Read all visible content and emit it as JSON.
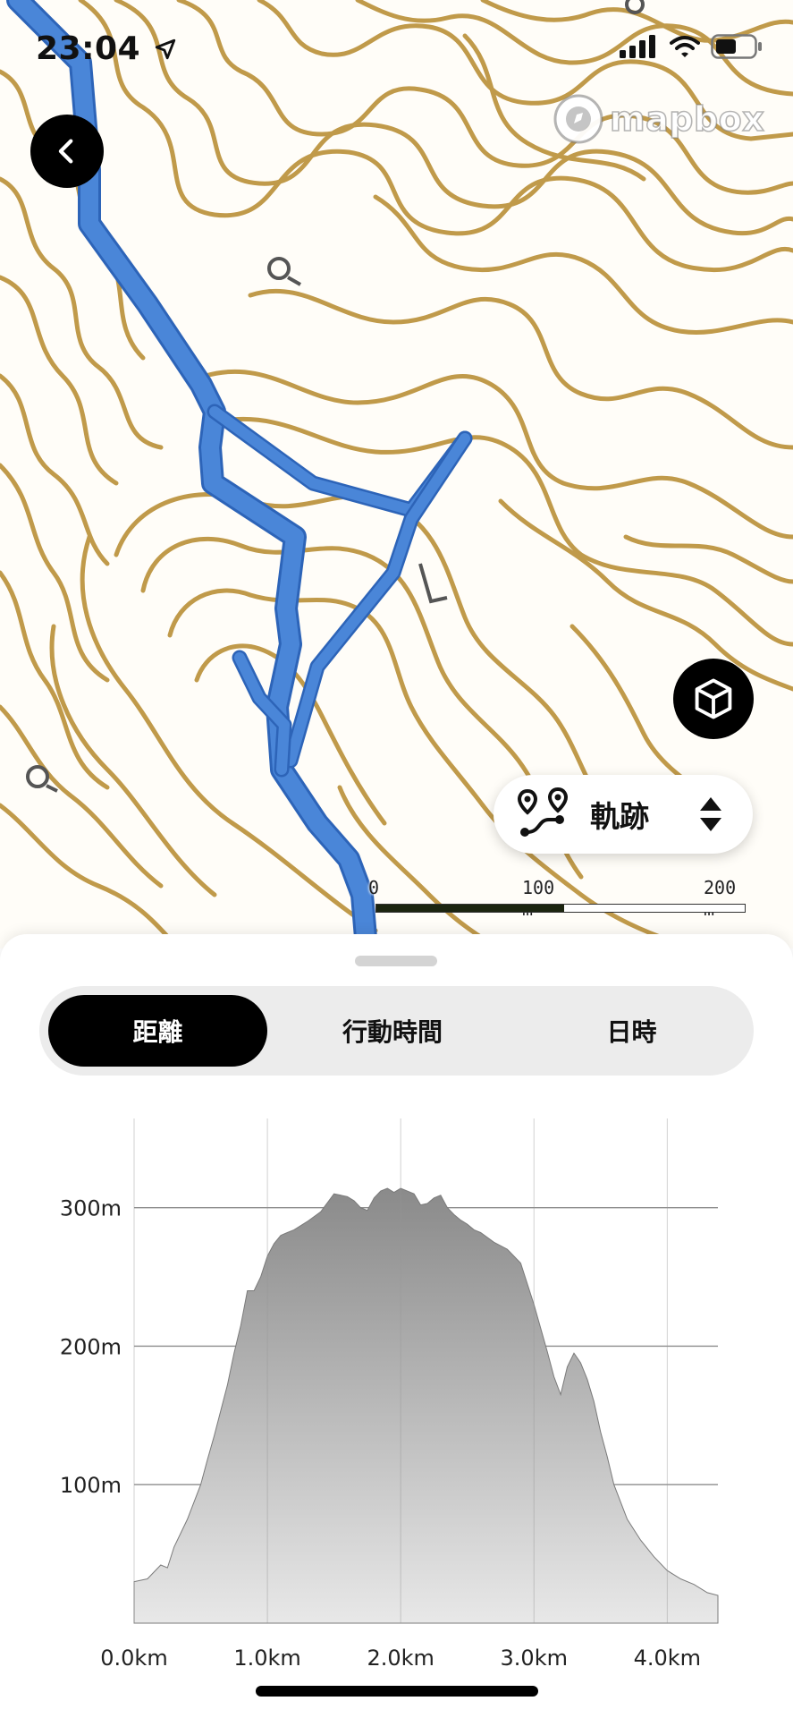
{
  "status_bar": {
    "time": "23:04"
  },
  "map": {
    "attribution": "mapbox",
    "contour_color": "#c09a4a",
    "track_color": "#4a86d8",
    "scale": {
      "labels": [
        "0",
        "100 m",
        "200 m"
      ]
    }
  },
  "buttons": {
    "back_icon": "chevron-left-icon",
    "view_3d_icon": "cube-icon",
    "track_selector": {
      "icon": "route-icon",
      "label": "軌跡",
      "icon_right": "sort-arrows-icon"
    }
  },
  "tabs": [
    {
      "label": "距離",
      "active": true
    },
    {
      "label": "行動時間",
      "active": false
    },
    {
      "label": "日時",
      "active": false
    }
  ],
  "chart_data": {
    "type": "area",
    "title": "",
    "xlabel": "",
    "ylabel": "",
    "x_unit": "km",
    "y_unit": "m",
    "x_ticks": [
      "0.0km",
      "1.0km",
      "2.0km",
      "3.0km",
      "4.0km"
    ],
    "y_ticks": [
      "100m",
      "200m",
      "300m"
    ],
    "xlim": [
      0,
      4.38
    ],
    "ylim": [
      0,
      345
    ],
    "grid": true,
    "series": [
      {
        "x": [
          0.0,
          0.1,
          0.2,
          0.25,
          0.3,
          0.4,
          0.5,
          0.55,
          0.6,
          0.7,
          0.75,
          0.8,
          0.85,
          0.9,
          0.95,
          1.0,
          1.05,
          1.1,
          1.15,
          1.2,
          1.3,
          1.4,
          1.5,
          1.6,
          1.65,
          1.7,
          1.75,
          1.8,
          1.85,
          1.9,
          1.95,
          2.0,
          2.05,
          2.1,
          2.15,
          2.2,
          2.25,
          2.3,
          2.35,
          2.4,
          2.45,
          2.5,
          2.55,
          2.6,
          2.7,
          2.8,
          2.9,
          3.0,
          3.1,
          3.15,
          3.2,
          3.25,
          3.3,
          3.35,
          3.4,
          3.45,
          3.5,
          3.55,
          3.6,
          3.7,
          3.8,
          3.9,
          4.0,
          4.1,
          4.2,
          4.3,
          4.38
        ],
        "y": [
          30,
          32,
          42,
          40,
          55,
          75,
          100,
          118,
          135,
          172,
          195,
          215,
          240,
          240,
          250,
          265,
          274,
          280,
          282,
          284,
          290,
          297,
          310,
          308,
          305,
          300,
          298,
          307,
          312,
          314,
          311,
          314,
          312,
          310,
          302,
          303,
          307,
          309,
          300,
          295,
          291,
          288,
          284,
          282,
          275,
          270,
          260,
          230,
          196,
          178,
          165,
          185,
          195,
          188,
          176,
          160,
          138,
          120,
          100,
          75,
          60,
          48,
          38,
          32,
          28,
          22,
          20
        ]
      }
    ]
  }
}
